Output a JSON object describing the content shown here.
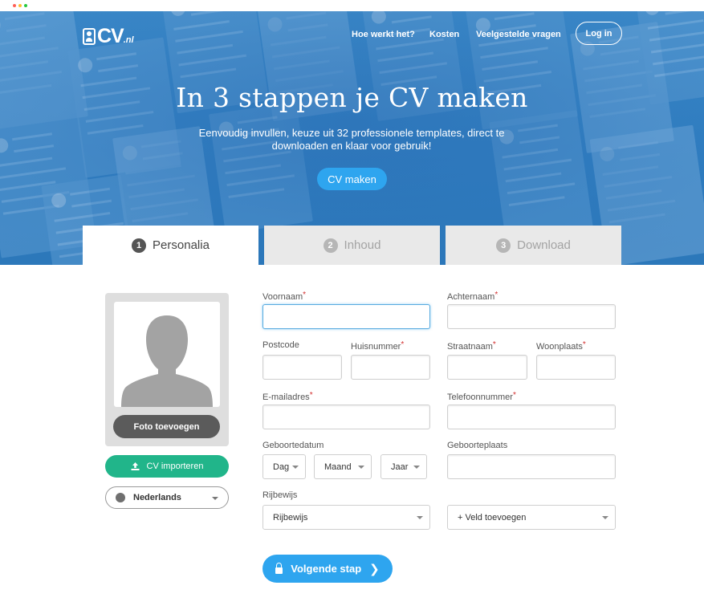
{
  "chrome": {
    "dot_colors": [
      "#ff5f56",
      "#ffbd2e",
      "#27c93f"
    ]
  },
  "brand": {
    "logo_main": "CV",
    "logo_suffix": ".nl"
  },
  "nav": {
    "items": [
      "Hoe werkt het?",
      "Kosten",
      "Veelgestelde vragen"
    ],
    "login_label": "Log in"
  },
  "hero": {
    "title": "In 3 stappen je CV maken",
    "subtitle": "Eenvoudig invullen, keuze uit 32 professionele templates, direct te downloaden en klaar voor gebruik!",
    "cta_label": "CV maken"
  },
  "steps": [
    {
      "num": "1",
      "label": "Personalia",
      "active": true
    },
    {
      "num": "2",
      "label": "Inhoud",
      "active": false
    },
    {
      "num": "3",
      "label": "Download",
      "active": false
    }
  ],
  "sidebar": {
    "photo_button": "Foto toevoegen",
    "import_button": "CV importeren",
    "language": "Nederlands"
  },
  "form": {
    "voornaam": "Voornaam",
    "achternaam": "Achternaam",
    "postcode": "Postcode",
    "huisnummer": "Huisnummer",
    "straatnaam": "Straatnaam",
    "woonplaats": "Woonplaats",
    "email": "E-mailadres",
    "telefoon": "Telefoonnummer",
    "geboortedatum": "Geboortedatum",
    "geboorteplaats": "Geboorteplaats",
    "rijbewijs": "Rijbewijs",
    "dag": "Dag",
    "maand": "Maand",
    "jaar": "Jaar",
    "rijbewijs_select": "Rijbewijs",
    "veld_toevoegen": "+ Veld toevoegen",
    "required_marker": "*",
    "next_button": "Volgende stap"
  },
  "colors": {
    "accent": "#2ea5ef",
    "import_green": "#21b58a",
    "hero_blue": "#2f7dc0",
    "required_red": "#d32f2f"
  }
}
